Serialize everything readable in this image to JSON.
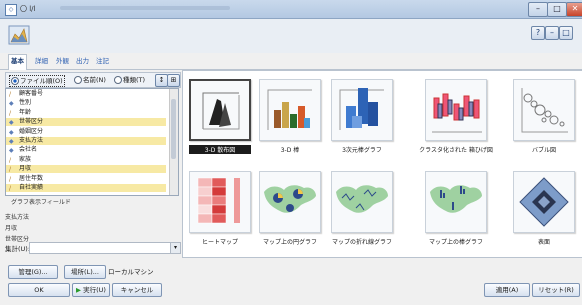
{
  "window": {
    "title": "〇 l/l"
  },
  "tabs": [
    "基本",
    "詳細",
    "外観",
    "出力",
    "注記"
  ],
  "field_selector": {
    "options": [
      "ファイル順(O)",
      "名前(N)",
      "種類(T)"
    ],
    "selected": "ファイル順(O)"
  },
  "fields": [
    {
      "name": "顧客番号",
      "highlight": false,
      "icon": "ruler"
    },
    {
      "name": "性別",
      "highlight": false,
      "icon": "set"
    },
    {
      "name": "年齢",
      "highlight": false,
      "icon": "ruler"
    },
    {
      "name": "世帯区分",
      "highlight": true,
      "icon": "set"
    },
    {
      "name": "婚姻区分",
      "highlight": false,
      "icon": "set"
    },
    {
      "name": "支払方法",
      "highlight": true,
      "icon": "set"
    },
    {
      "name": "会社名",
      "highlight": false,
      "icon": "set"
    },
    {
      "name": "家族",
      "highlight": false,
      "icon": "ruler"
    },
    {
      "name": "月収",
      "highlight": true,
      "icon": "ruler"
    },
    {
      "name": "居住年数",
      "highlight": false,
      "icon": "ruler"
    },
    {
      "name": "自社実績",
      "highlight": true,
      "icon": "ruler"
    }
  ],
  "summary_header": "グラフ表示フィールド",
  "summary_fields": [
    "支払方法",
    "月収",
    "世帯区分"
  ],
  "panel_label": "集計(U):",
  "gallery": [
    {
      "label": "3-D 散布図",
      "selected": true,
      "kind": "scatter3d"
    },
    {
      "label": "3-D 棒",
      "selected": false,
      "kind": "bar3d"
    },
    {
      "label": "3次元棒グラフ",
      "selected": false,
      "kind": "bar3dblue"
    },
    {
      "label": "クラスタ化された 箱ひげ図",
      "selected": false,
      "kind": "boxplot"
    },
    {
      "label": "バブル図",
      "selected": false,
      "kind": "bubble"
    },
    {
      "label": "ヒートマップ",
      "selected": false,
      "kind": "heatmap"
    },
    {
      "label": "マップ上の円グラフ",
      "selected": false,
      "kind": "mappie"
    },
    {
      "label": "マップの折れ線グラフ",
      "selected": false,
      "kind": "mapline"
    },
    {
      "label": "マップ上の棒グラフ",
      "selected": false,
      "kind": "mapbar"
    },
    {
      "label": "表面",
      "selected": false,
      "kind": "surface"
    }
  ],
  "bottom": {
    "manage": "管理(G)...",
    "location": "場所(L)...",
    "location_value": "ローカルマシン",
    "ok": "OK",
    "run": "実行(U)",
    "cancel": "キャンセル",
    "apply": "適用(A)",
    "reset": "リセット(R)"
  }
}
